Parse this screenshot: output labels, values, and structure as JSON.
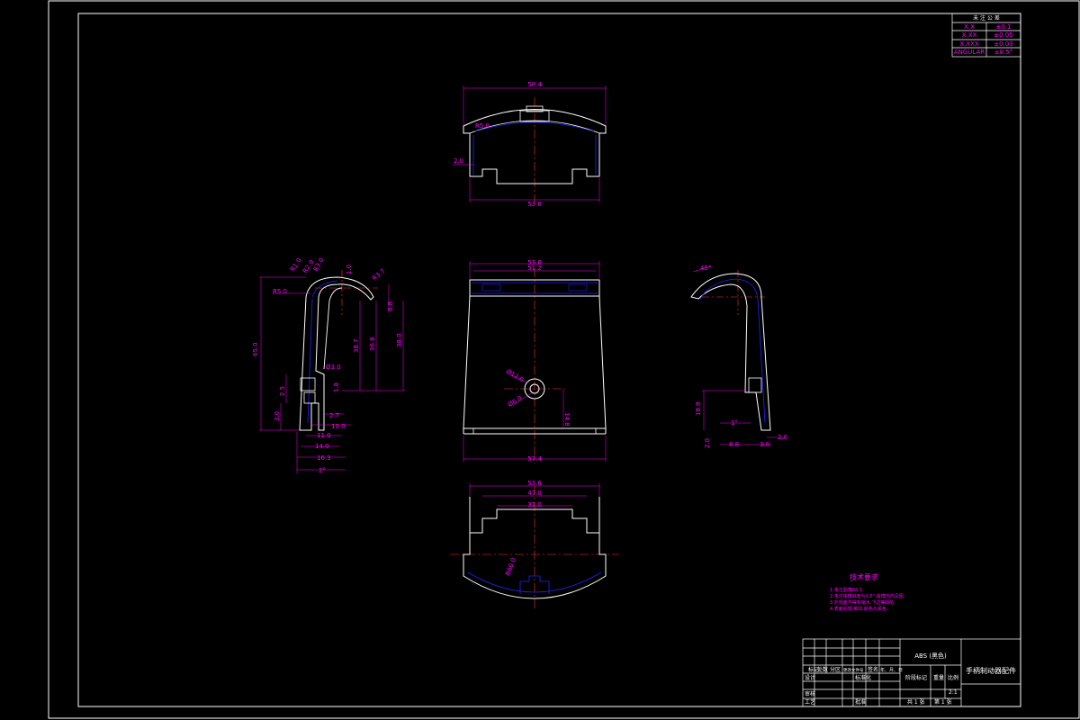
{
  "title_block": {
    "material": "ABS (黑色)",
    "part_name": "手柄制动器配件",
    "scale": "2:1",
    "sheet_total": "共 1 张",
    "sheet_no": "第 1 张",
    "row_labels": [
      "标记",
      "处数",
      "分区",
      "更改文件号",
      "签名",
      "年、月、日"
    ],
    "role_labels": [
      "设计",
      "审核",
      "工艺",
      "标准化",
      "批准"
    ],
    "stage_labels": [
      "阶段标记",
      "重量",
      "比例"
    ]
  },
  "tolerance_table": {
    "header": "未 注 公 差",
    "rows": [
      {
        "left": "X.X",
        "right": "±0.1"
      },
      {
        "left": "X.XX",
        "right": "±0.05"
      },
      {
        "left": "X.XXX",
        "right": "±0.03"
      },
      {
        "left": "ANGULAR",
        "right": "±0.5°"
      }
    ]
  },
  "tech_notes": {
    "title": "技术要求",
    "lines": [
      "1.未注圆角R0.5.",
      "2.未注拔模斜度为0.5°,拔模方向见图.",
      "3.外观面不得有缩水,飞边等缺陷.",
      "4.表面处理:细纹,颜色为黑色."
    ]
  },
  "top_view": {
    "dims": {
      "overall_width": "58.4",
      "bottom_width": "53.6",
      "wall": "2.0",
      "fillet": "R5.0"
    }
  },
  "front_view": {
    "dims": {
      "top_width": "53.6",
      "top_inner": "51.2",
      "bottom_width": "57.4",
      "hole": "Ø12.0",
      "hole_inner": "Ø6.0",
      "hole_height": "14.8"
    }
  },
  "bottom_view": {
    "dims": {
      "outer_width": "53.6",
      "pocket_width": "47.0",
      "inner_width": "31.0",
      "radius": "R60.0"
    }
  },
  "left_view": {
    "dims": {
      "total_height": "65.0",
      "r_top": "R5.0",
      "r1": "R1.0",
      "r2": "R2.0",
      "r3": "R3.0",
      "ang": "R3.7",
      "top_step": "1.0",
      "h1": "0.8",
      "h2": "38.7",
      "h3": "36.8",
      "h4": "38.0",
      "slot_w": "2.5",
      "slot_h": "3.0",
      "slot_d": "1.8",
      "w1": "2.7",
      "w2": "10.0",
      "w3": "11.0",
      "w4": "14.0",
      "w5": "16.3",
      "a1": "2°",
      "r5": "Ø3.0"
    }
  },
  "right_view": {
    "dims": {
      "angle": "45°",
      "h": "18.0",
      "a": "1°",
      "w1": "2.0",
      "w2": "8.8",
      "w3": "3.0",
      "w4": "2.0"
    }
  }
}
